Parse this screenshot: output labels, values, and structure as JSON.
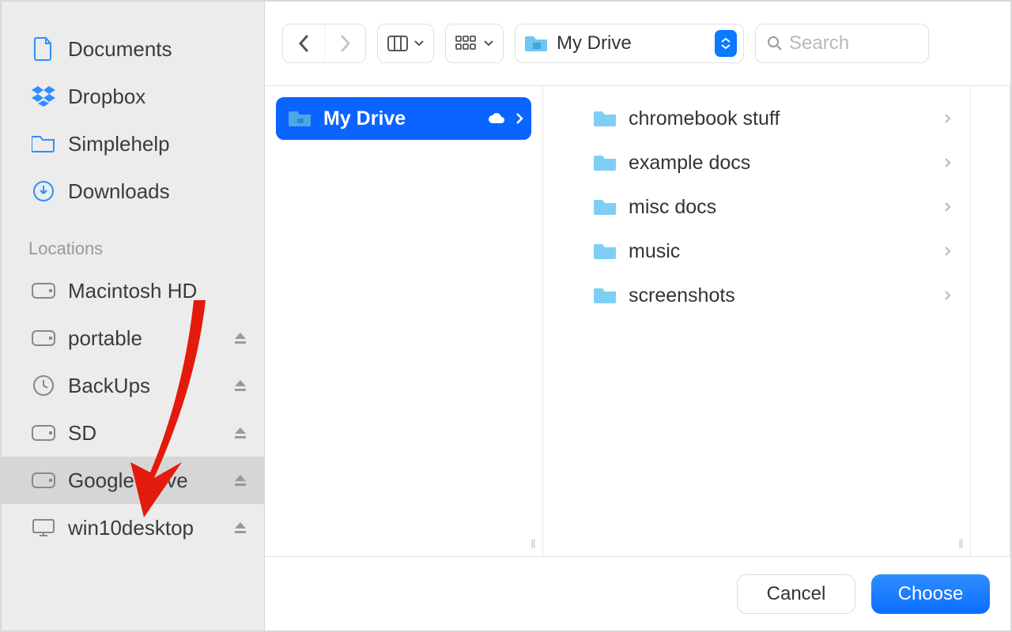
{
  "sidebar": {
    "favorites": [
      {
        "icon": "document-icon",
        "label": "Documents"
      },
      {
        "icon": "dropbox-icon",
        "label": "Dropbox"
      },
      {
        "icon": "folder-icon",
        "label": "Simplehelp"
      },
      {
        "icon": "download-icon",
        "label": "Downloads"
      }
    ],
    "locations_header": "Locations",
    "locations": [
      {
        "icon": "disk-icon",
        "label": "Macintosh HD",
        "ejectable": false
      },
      {
        "icon": "disk-icon",
        "label": "portable",
        "ejectable": true
      },
      {
        "icon": "timemachine-icon",
        "label": "BackUps",
        "ejectable": true
      },
      {
        "icon": "disk-icon",
        "label": "SD",
        "ejectable": true
      },
      {
        "icon": "disk-icon",
        "label": "Google Drive",
        "ejectable": true,
        "selected": true
      },
      {
        "icon": "computer-icon",
        "label": "win10desktop",
        "ejectable": true
      }
    ]
  },
  "toolbar": {
    "location_label": "My Drive",
    "search_placeholder": "Search"
  },
  "columns": {
    "col1": [
      {
        "label": "My Drive",
        "cloud": true,
        "selected": true
      }
    ],
    "col2": [
      {
        "label": "chromebook stuff"
      },
      {
        "label": "example docs"
      },
      {
        "label": "misc docs"
      },
      {
        "label": "music"
      },
      {
        "label": "screenshots"
      }
    ]
  },
  "footer": {
    "cancel": "Cancel",
    "choose": "Choose"
  },
  "annotation": {
    "points_to": "Google Drive"
  }
}
